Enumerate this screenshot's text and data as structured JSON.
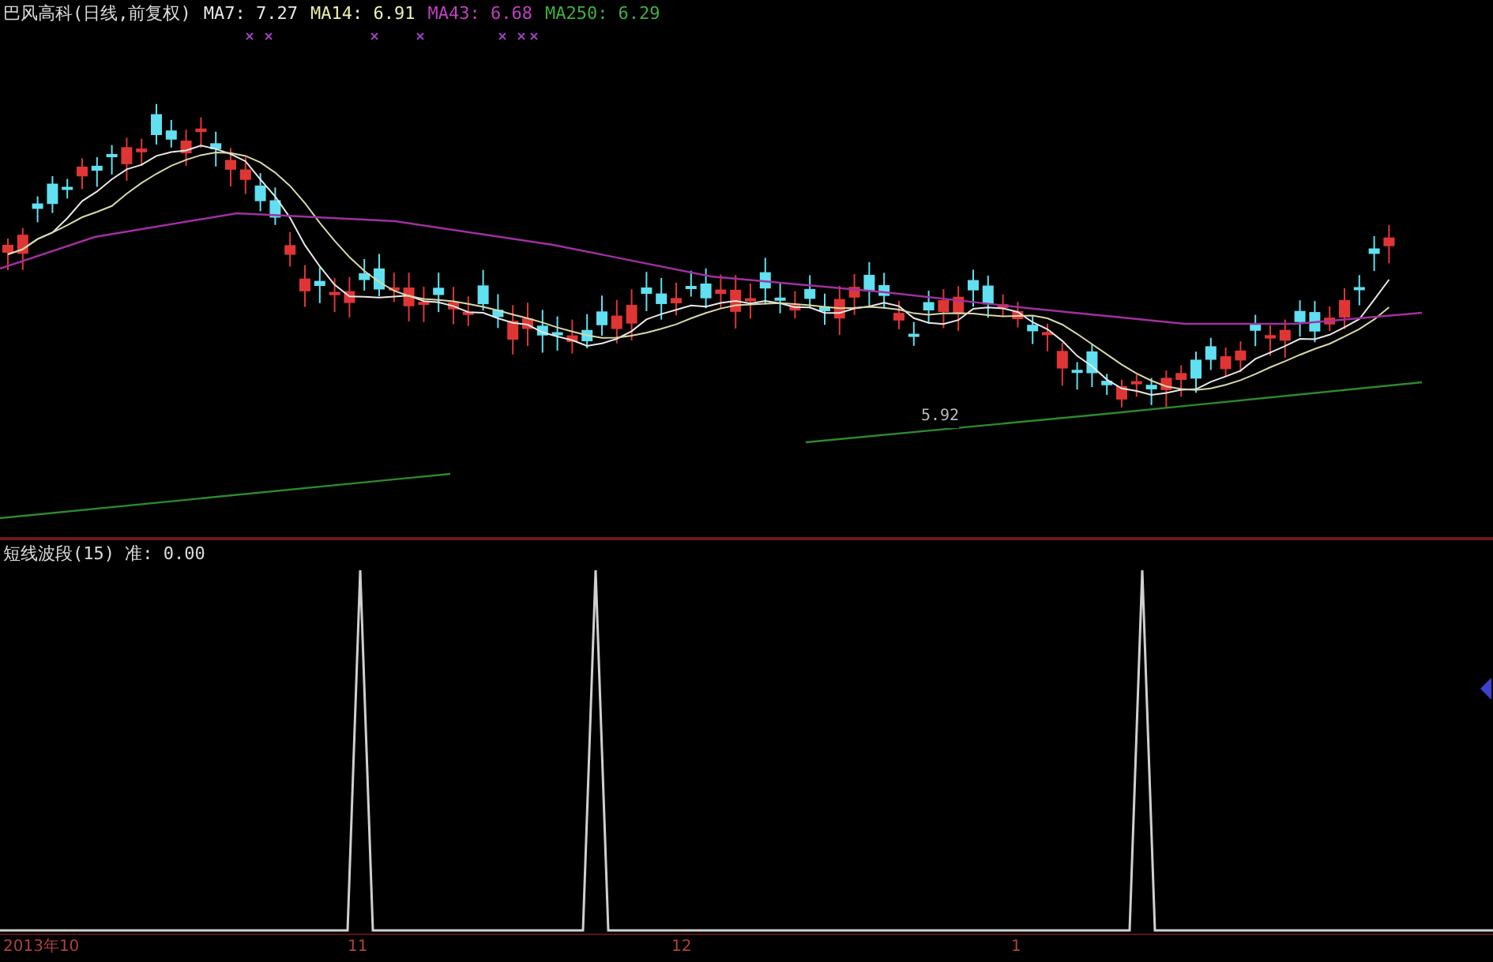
{
  "header": {
    "title": "巴风高科(日线,前复权)",
    "ma": [
      {
        "label": "MA7:",
        "value": "7.27",
        "color": "#e8e8e8"
      },
      {
        "label": "MA14:",
        "value": "6.91",
        "color": "#f0f0b0"
      },
      {
        "label": "MA43:",
        "value": "6.68",
        "color": "#c040c0"
      },
      {
        "label": "MA250:",
        "value": "6.29",
        "color": "#40b040"
      }
    ]
  },
  "main_chart": {
    "low_price_label": "5.92"
  },
  "indicator": {
    "label": "短线波段(15) 准: 0.00"
  },
  "x_axis": {
    "labels": [
      "2013年10",
      "11",
      "12",
      "1"
    ]
  }
}
